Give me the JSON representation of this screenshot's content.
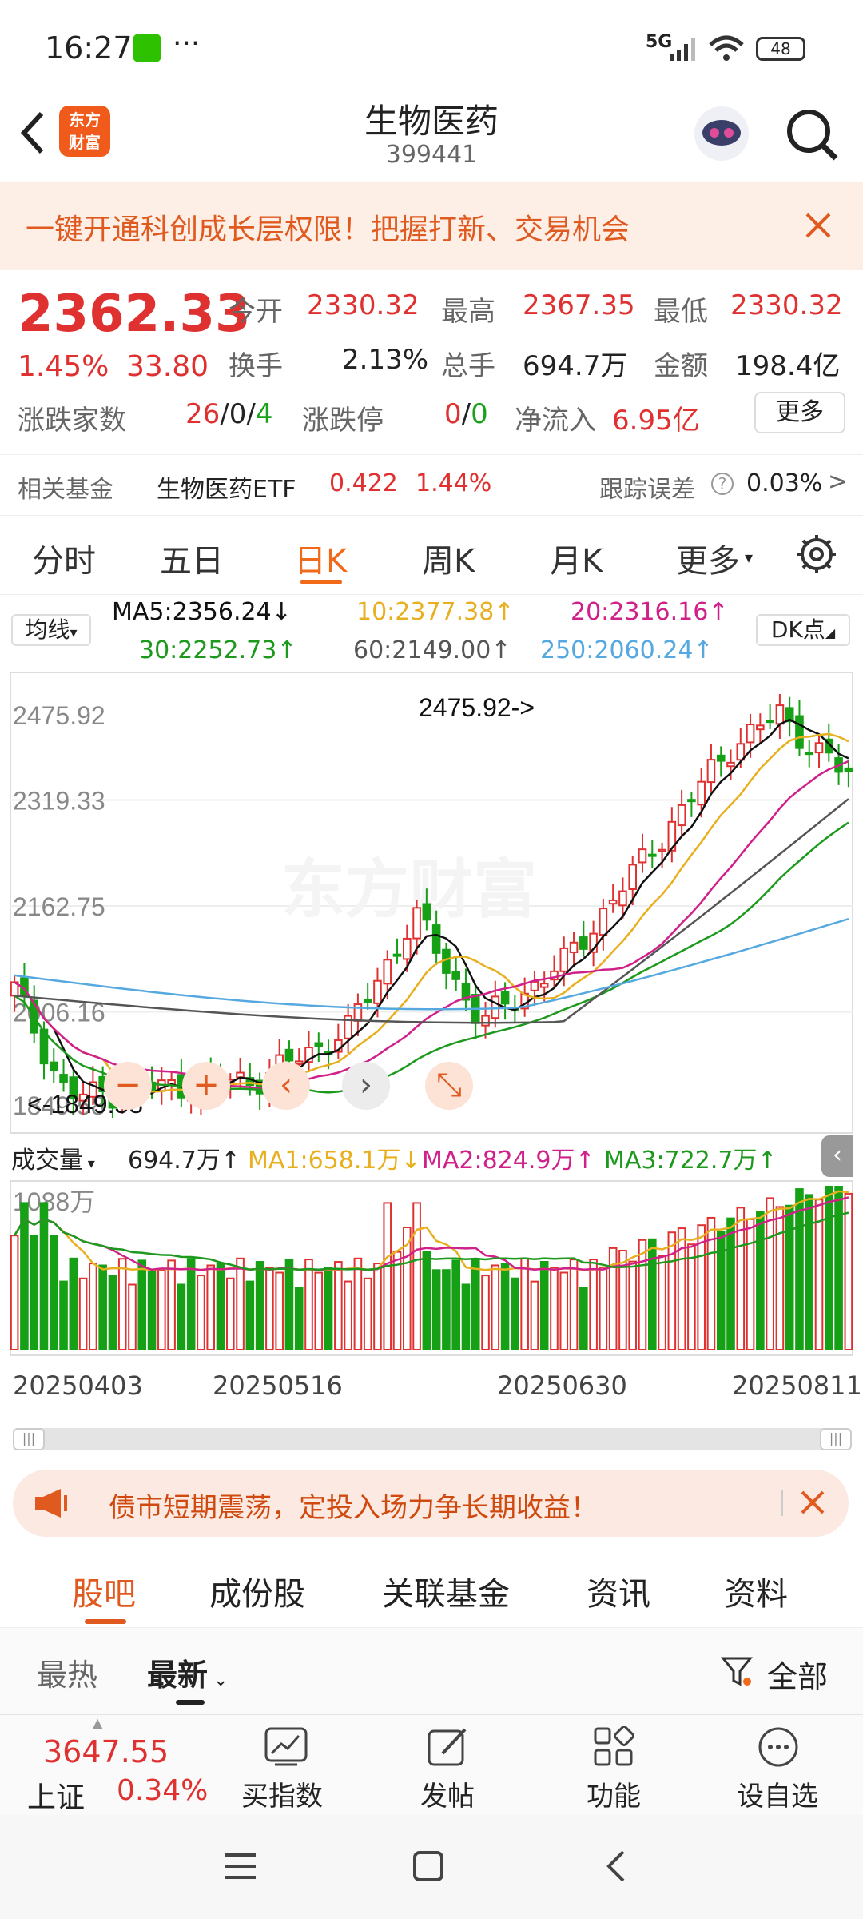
{
  "status": {
    "time": "16:27",
    "more": "···",
    "net": "5G",
    "battery": "48"
  },
  "header": {
    "title": "生物医药",
    "code": "399441",
    "logo_top": "东方",
    "logo_bottom": "财富"
  },
  "banner": {
    "text": "一键开通科创成长层权限！把握打新、交易机会"
  },
  "quote": {
    "price": "2362.33",
    "pct": "1.45%",
    "chg": "33.80",
    "open_label": "今开",
    "open": "2330.32",
    "high_label": "最高",
    "high": "2367.35",
    "low_label": "最低",
    "low": "2330.32",
    "turnover_label": "换手",
    "turnover": "2.13%",
    "volume_label": "总手",
    "volume": "694.7万",
    "amount_label": "金额",
    "amount": "198.4亿",
    "adv_label": "涨跌家数",
    "adv_up": "26",
    "adv_sep1": "/",
    "adv_flat": "0",
    "adv_sep2": "/",
    "adv_down": "4",
    "limit_label": "涨跌停",
    "limit_up": "0",
    "limit_sep": "/",
    "limit_down": "0",
    "inflow_label": "净流入",
    "inflow": "6.95亿",
    "more": "更多"
  },
  "fund": {
    "label": "相关基金",
    "name": "生物医药ETF",
    "price": "0.422",
    "pct": "1.44%",
    "track_label": "跟踪误差",
    "track": "0.03%",
    "arrow": ">"
  },
  "tabs": [
    "分时",
    "五日",
    "日K",
    "周K",
    "月K",
    "更多"
  ],
  "active_tab": "日K",
  "ma": {
    "selector": "均线",
    "ma5": "MA5:2356.24↓",
    "ma10": "10:2377.38↑",
    "ma20": "20:2316.16↑",
    "ma30": "30:2252.73↑",
    "ma60": "60:2149.00↑",
    "ma250": "250:2060.24↑",
    "dk": "DK点"
  },
  "chart_labels": {
    "y1": "2475.92",
    "y2": "2319.33",
    "y3": "2162.75",
    "y4": "2006.16",
    "y5": "1849.58",
    "max": "2475.92->",
    "min": "<-1849.58",
    "watermark": "东方财富"
  },
  "colors": {
    "up": "#e03131",
    "down": "#16a016",
    "ma5": "#111111",
    "ma10": "#e8b020",
    "ma20": "#d0208a",
    "ma30": "#1d9a1d",
    "ma60": "#555555",
    "ma250": "#56a9e0",
    "accent": "#f06a1a"
  },
  "volume": {
    "selector": "成交量",
    "vol": "694.7万↑",
    "ma1": "MA1:658.1万↓",
    "ma2": "MA2:824.9万↑",
    "ma3": "MA3:722.7万↑",
    "ymax": "1088万"
  },
  "dates": [
    "20250403",
    "20250516",
    "20250630",
    "20250811"
  ],
  "promo": {
    "text": "债市短期震荡，定投入场力争长期收益！"
  },
  "subtabs": [
    "股吧",
    "成份股",
    "关联基金",
    "资讯",
    "资料"
  ],
  "sort": {
    "hot": "最热",
    "latest": "最新",
    "filter": "全部"
  },
  "bottom": {
    "index_value": "3647.55",
    "index_name": "上证",
    "index_pct": "0.34%",
    "buy": "买指数",
    "post": "发帖",
    "func": "功能",
    "fav": "设自选"
  },
  "chart_data": {
    "type": "candlestick",
    "ylim": [
      1849.58,
      2475.92
    ],
    "y_ticks": [
      2475.92,
      2319.33,
      2162.75,
      2006.16,
      1849.58
    ],
    "x_ticks": [
      "20250403",
      "20250516",
      "20250630",
      "20250811"
    ],
    "high": 2475.92,
    "low": 1849.58,
    "last_close": 2362.33,
    "volume_max": "1088万"
  }
}
